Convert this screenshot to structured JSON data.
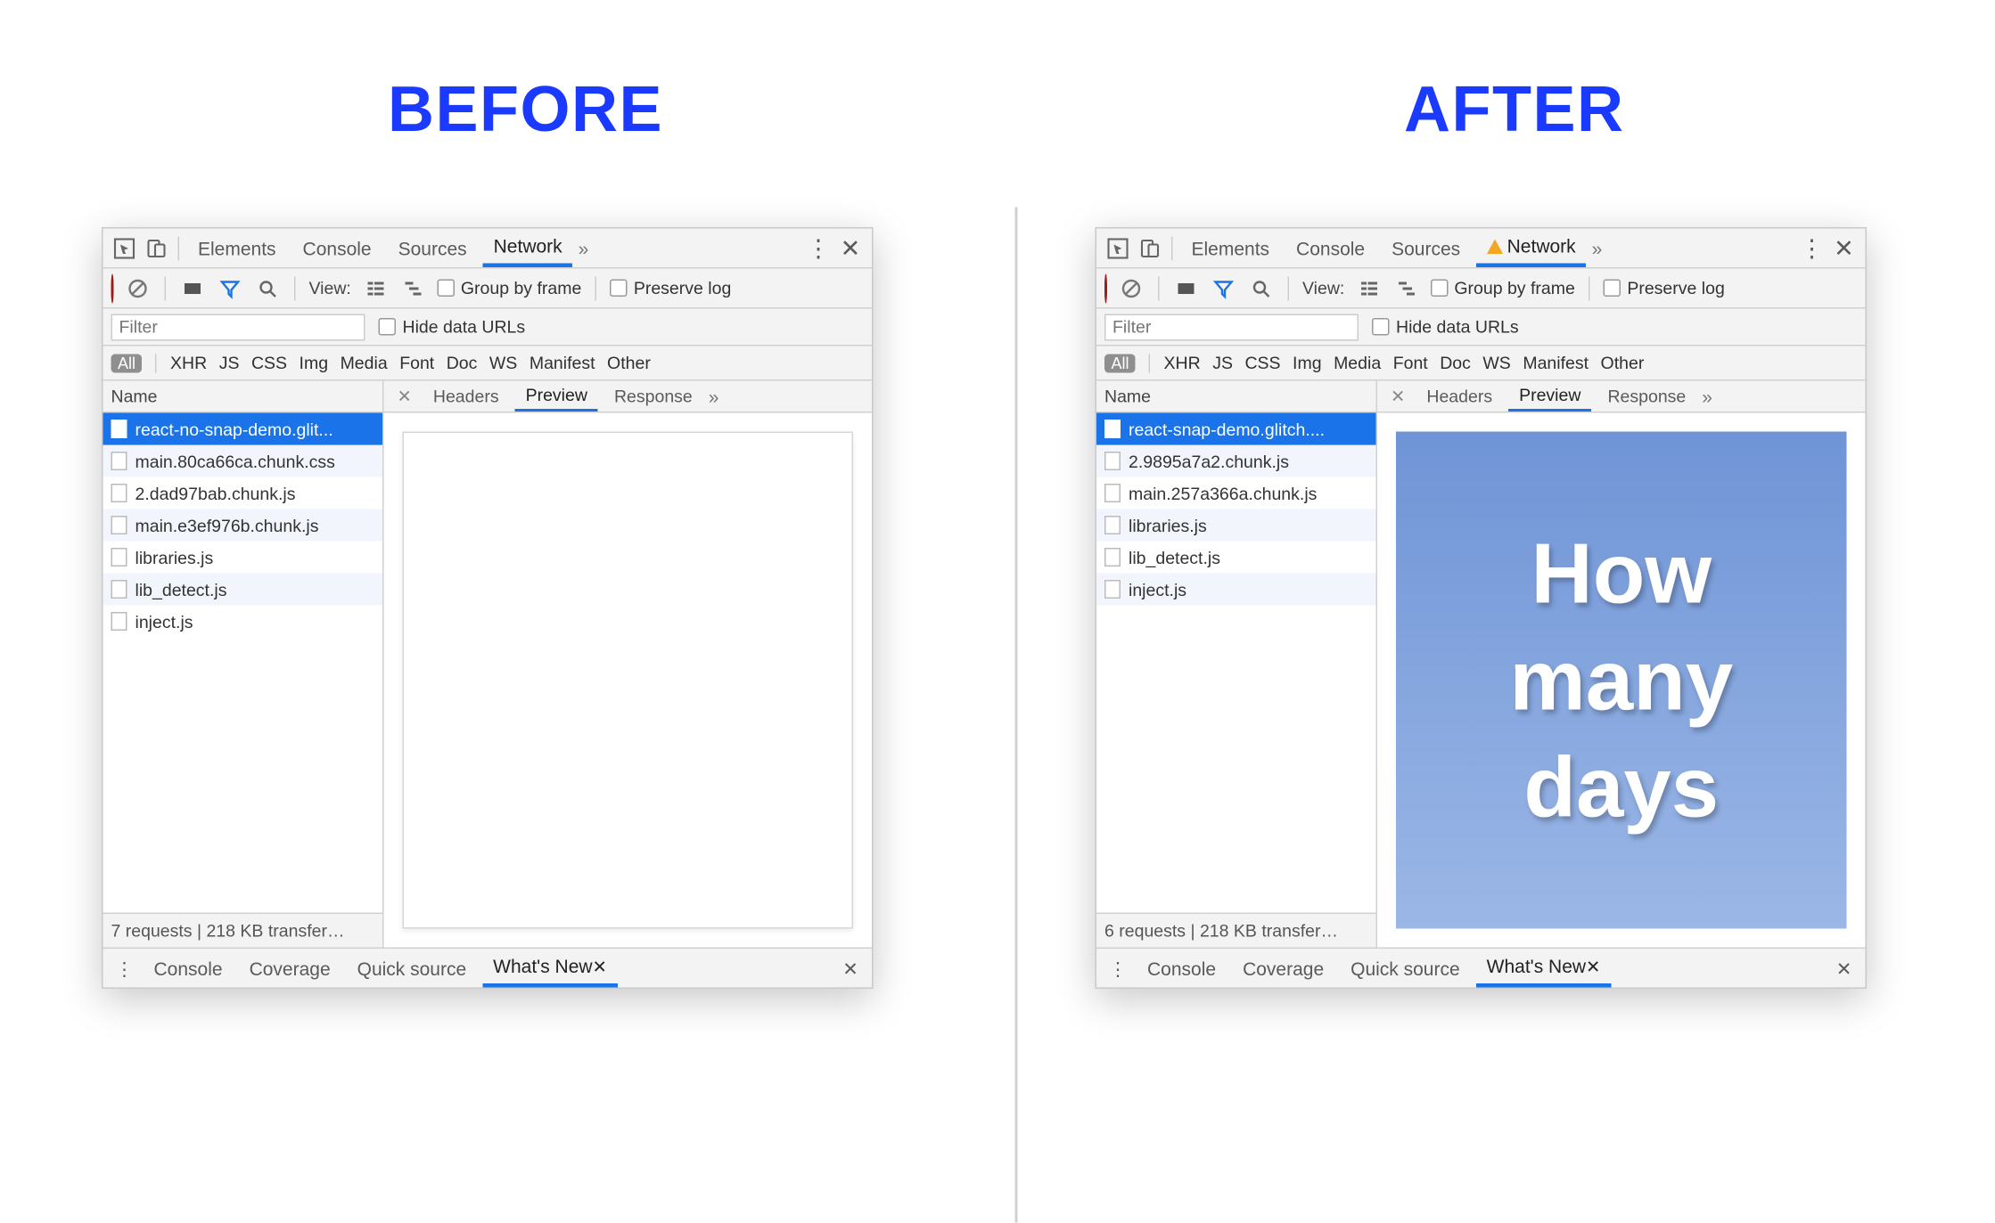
{
  "headings": {
    "before": "BEFORE",
    "after": "AFTER"
  },
  "shared": {
    "topTabs": [
      "Elements",
      "Console",
      "Sources",
      "Network"
    ],
    "toolbar": {
      "viewLabel": "View:",
      "groupByFrame": "Group by frame",
      "preserveLog": "Preserve log"
    },
    "filterRow": {
      "placeholder": "Filter",
      "hideDataUrls": "Hide data URLs"
    },
    "typeFilters": [
      "XHR",
      "JS",
      "CSS",
      "Img",
      "Media",
      "Font",
      "Doc",
      "WS",
      "Manifest",
      "Other"
    ],
    "allPill": "All",
    "nameHeader": "Name",
    "detailTabs": [
      "Headers",
      "Preview",
      "Response"
    ],
    "drawerTabs": [
      "Console",
      "Coverage",
      "Quick source",
      "What's New"
    ],
    "drawerActive": "What's New"
  },
  "before": {
    "networkWarn": false,
    "requests": [
      "react-no-snap-demo.glit...",
      "main.80ca66ca.chunk.css",
      "2.dad97bab.chunk.js",
      "main.e3ef976b.chunk.js",
      "libraries.js",
      "lib_detect.js",
      "inject.js"
    ],
    "status": "7 requests | 218 KB transfer…",
    "previewText": []
  },
  "after": {
    "networkWarn": true,
    "requests": [
      "react-snap-demo.glitch....",
      "2.9895a7a2.chunk.js",
      "main.257a366a.chunk.js",
      "libraries.js",
      "lib_detect.js",
      "inject.js"
    ],
    "status": "6 requests | 218 KB transfer…",
    "previewText": [
      "How",
      "many",
      "days"
    ]
  }
}
